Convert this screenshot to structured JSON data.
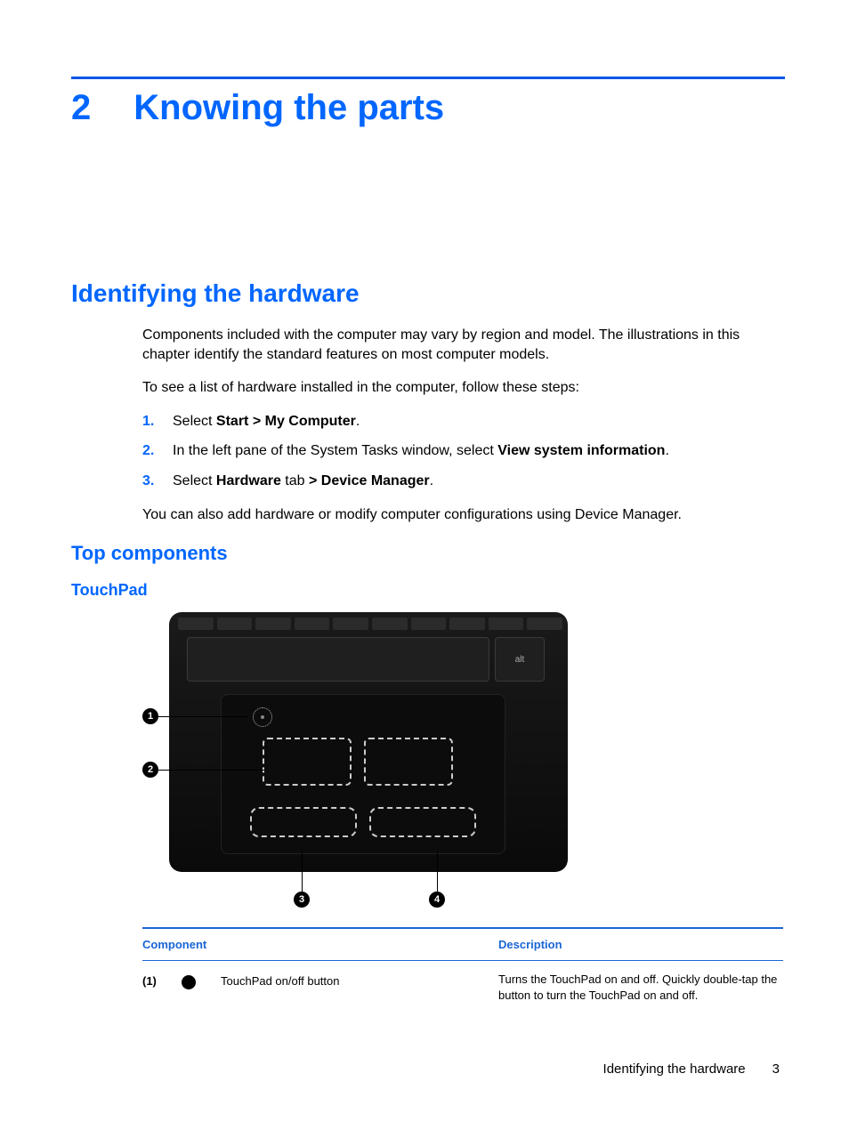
{
  "chapter": {
    "number": "2",
    "title": "Knowing the parts"
  },
  "sections": {
    "identifying": {
      "heading": "Identifying the hardware",
      "intro": "Components included with the computer may vary by region and model. The illustrations in this chapter identify the standard features on most computer models.",
      "lead": "To see a list of hardware installed in the computer, follow these steps:",
      "steps": [
        {
          "n": "1.",
          "pre": "Select ",
          "bold": "Start > My Computer",
          "post": "."
        },
        {
          "n": "2.",
          "pre": "In the left pane of the System Tasks window, select ",
          "bold": "View system information",
          "post": "."
        },
        {
          "n": "3.",
          "pre": "Select ",
          "bold": "Hardware",
          "mid": " tab ",
          "bold2": "> Device Manager",
          "post": "."
        }
      ],
      "note": "You can also add hardware or modify computer configurations using Device Manager."
    },
    "top_components": "Top components",
    "touchpad": "TouchPad"
  },
  "figure": {
    "alt_key": "alt",
    "callouts": {
      "c1": "1",
      "c2": "2",
      "c3": "3",
      "c4": "4"
    }
  },
  "table": {
    "head_component": "Component",
    "head_description": "Description",
    "rows": [
      {
        "num": "(1)",
        "name": "TouchPad on/off button",
        "desc": "Turns the TouchPad on and off. Quickly double-tap the button to turn the TouchPad on and off."
      }
    ]
  },
  "footer": {
    "section": "Identifying the hardware",
    "page": "3"
  }
}
